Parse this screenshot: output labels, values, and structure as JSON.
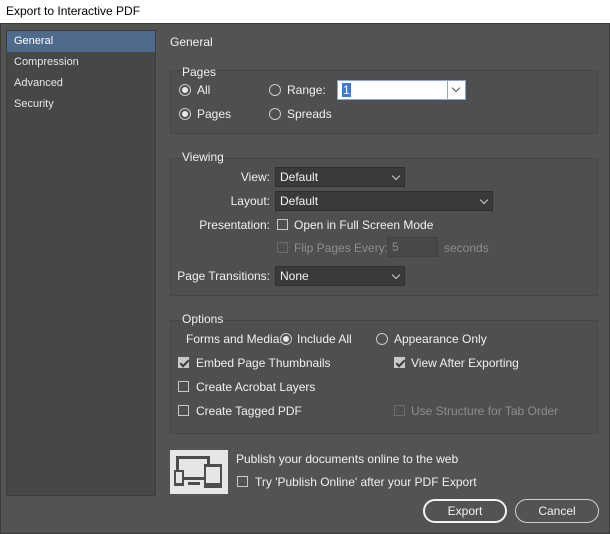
{
  "window": {
    "title": "Export to Interactive PDF"
  },
  "sidebar": {
    "items": [
      {
        "label": "General"
      },
      {
        "label": "Compression"
      },
      {
        "label": "Advanced"
      },
      {
        "label": "Security"
      }
    ]
  },
  "header": {
    "title": "General"
  },
  "pages": {
    "title": "Pages",
    "all_label": "All",
    "range_label": "Range:",
    "range_value": "1",
    "pages_label": "Pages",
    "spreads_label": "Spreads"
  },
  "viewing": {
    "title": "Viewing",
    "view_label": "View:",
    "view_value": "Default",
    "layout_label": "Layout:",
    "layout_value": "Default",
    "presentation_label": "Presentation:",
    "fullscreen_label": "Open in Full Screen Mode",
    "flip_label": "Flip Pages Every:",
    "flip_value": "5",
    "seconds_label": "seconds",
    "transitions_label": "Page Transitions:",
    "transitions_value": "None"
  },
  "options": {
    "title": "Options",
    "forms_label": "Forms and Media:",
    "include_all_label": "Include All",
    "appearance_only_label": "Appearance Only",
    "embed_thumbs_label": "Embed Page Thumbnails",
    "view_after_label": "View After Exporting",
    "acrobat_layers_label": "Create Acrobat Layers",
    "tagged_pdf_label": "Create Tagged PDF",
    "structure_tab_label": "Use Structure for Tab Order"
  },
  "publish": {
    "headline": "Publish your documents online to the web",
    "try_label": "Try 'Publish Online' after your PDF Export"
  },
  "buttons": {
    "export": "Export",
    "cancel": "Cancel"
  }
}
